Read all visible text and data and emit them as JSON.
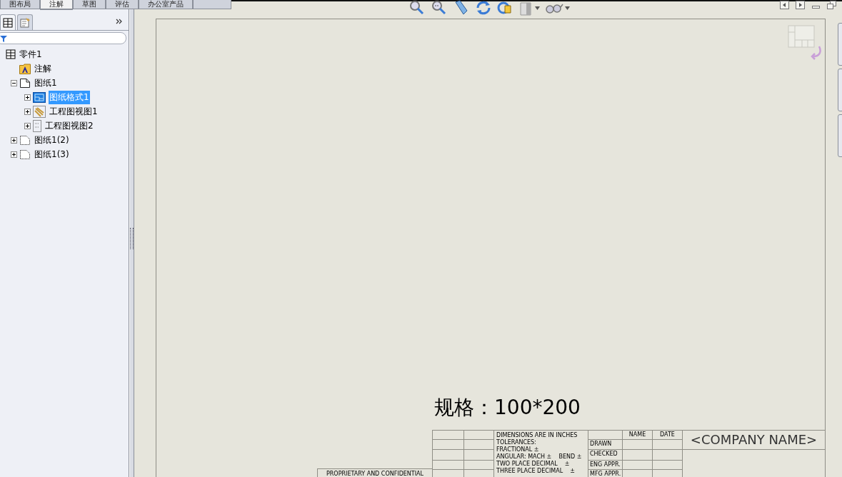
{
  "command_tabs": [
    {
      "label": "图布局",
      "selected": false
    },
    {
      "label": "注解",
      "selected": true
    },
    {
      "label": "草图",
      "selected": false
    },
    {
      "label": "评估",
      "selected": false
    },
    {
      "label": "办公室产品",
      "selected": false
    }
  ],
  "tree": [
    {
      "label": "零件1",
      "kind": "part",
      "selected": false,
      "children": [
        {
          "label": "注解",
          "kind": "annotations",
          "selected": false
        },
        {
          "label": "图纸1",
          "kind": "sheet",
          "selected": false,
          "expanded": true,
          "children": [
            {
              "label": "图纸格式1",
              "kind": "sheet-format",
              "selected": true,
              "expanded": false
            },
            {
              "label": "工程图视图1",
              "kind": "view",
              "selected": false,
              "expanded": false
            },
            {
              "label": "工程图视图2",
              "kind": "view-empty",
              "selected": false,
              "expanded": false
            }
          ]
        },
        {
          "label": "图纸1(2)",
          "kind": "sheet-hidden",
          "selected": false,
          "expanded": false
        },
        {
          "label": "图纸1(3)",
          "kind": "sheet-hidden",
          "selected": false,
          "expanded": false
        }
      ]
    }
  ],
  "drawing": {
    "spec_text": "规格：100*200",
    "title_block": {
      "notes": [
        "DIMENSIONS ARE IN INCHES",
        "TOLERANCES:",
        "FRACTIONAL ±",
        "ANGULAR: MACH ±    BEND ±",
        "TWO PLACE DECIMAL    ±",
        "THREE PLACE DECIMAL    ±"
      ],
      "headers": [
        "NAME",
        "DATE"
      ],
      "signoffs": [
        "DRAWN",
        "CHECKED",
        "ENG APPR.",
        "MFG APPR."
      ],
      "company": "<COMPANY NAME>",
      "proprietary": "PROPRIETARY AND CONFIDENTIAL"
    }
  }
}
